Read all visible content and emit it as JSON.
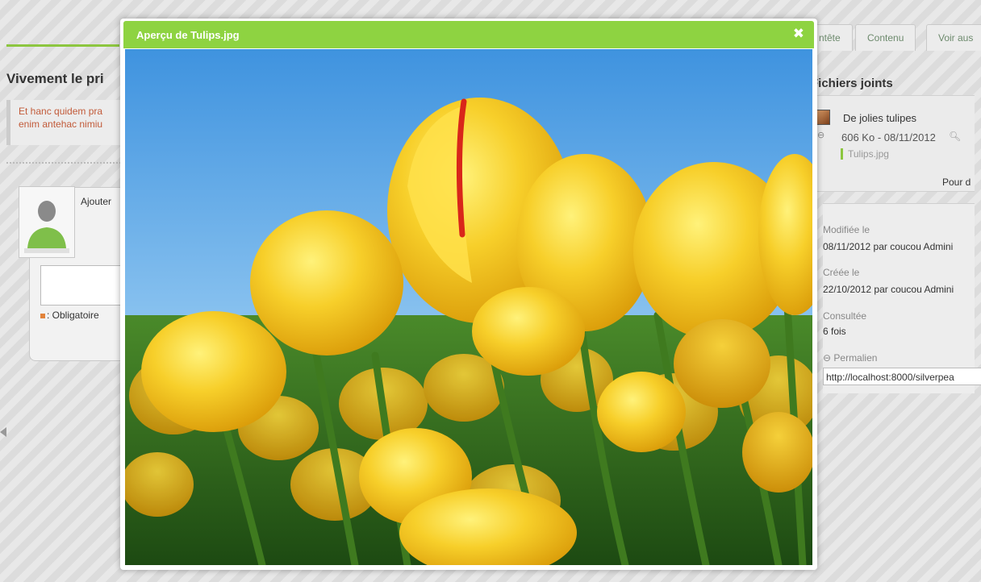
{
  "tabs": [
    {
      "label": "ntête"
    },
    {
      "label": "Contenu"
    },
    {
      "label": "Voir aus"
    }
  ],
  "publication": {
    "title": "Vivement le pri",
    "excerpt_line1": "Et hanc quidem pra",
    "excerpt_line2": "enim antehac nimiu"
  },
  "comments": {
    "add_label": "Ajouter",
    "required_label": ": Obligatoire"
  },
  "attachments": {
    "title": "Fichiers joints",
    "file_title": "De jolies tulipes",
    "file_meta": "606 Ko - 08/11/2012",
    "file_name": "Tulips.jpg",
    "more_label": "Pour d",
    "icons": {
      "file": "image-file-icon",
      "link": "link-icon",
      "zoom": "magnifier-icon"
    }
  },
  "info": {
    "modified_label": "Modifiée le",
    "modified_date": "08/11/2012",
    "modified_by": "par coucou Admini",
    "created_label": "Créée le",
    "created_date": "22/10/2012",
    "created_by": "par coucou Admini",
    "views_label": "Consultée",
    "views_value": "6 fois",
    "permalink_label": "Permalien",
    "permalink_value": "http://localhost:8000/silverpea"
  },
  "modal": {
    "title": "Aperçu de Tulips.jpg",
    "close_symbol": "✖",
    "image_subject": "yellow tulips against blue sky"
  },
  "colors": {
    "header_green": "#8ed341",
    "accent_green": "#8cc63f",
    "required_orange": "#e2833a"
  }
}
